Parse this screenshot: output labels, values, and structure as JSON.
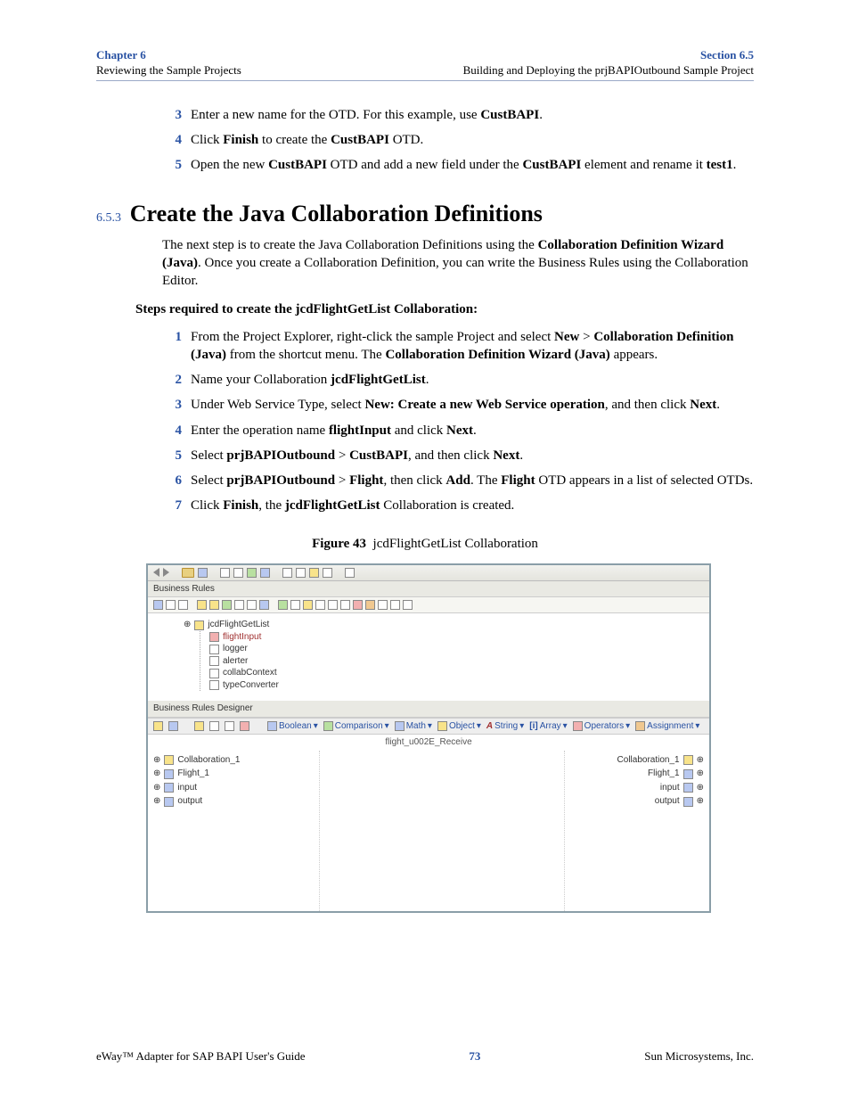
{
  "header": {
    "chapter_label": "Chapter 6",
    "chapter_sub": "Reviewing the Sample Projects",
    "section_label": "Section 6.5",
    "section_sub": "Building and Deploying the prjBAPIOutbound Sample Project"
  },
  "intro_steps": {
    "s3": {
      "n": "3",
      "pre": "Enter a new name for the OTD. For this example, use ",
      "b1": "CustBAPI",
      "post": "."
    },
    "s4": {
      "n": "4",
      "pre": "Click ",
      "b1": "Finish",
      "mid": " to create the ",
      "b2": "CustBAPI",
      "post": " OTD."
    },
    "s5": {
      "n": "5",
      "pre": "Open the new ",
      "b1": "CustBAPI",
      "mid": " OTD and add a new field under the ",
      "b2": "CustBAPI",
      "mid2": " element and rename it ",
      "b3": "test1",
      "post": "."
    }
  },
  "section": {
    "num": "6.5.3",
    "title": "Create the Java Collaboration Definitions"
  },
  "para1": {
    "pre": "The next step is to create the Java Collaboration Definitions using the ",
    "b1": "Collaboration Definition Wizard (Java)",
    "post": ". Once you create a Collaboration Definition, you can write the Business Rules using the Collaboration Editor."
  },
  "subhead": "Steps required to create the jcdFlightGetList Collaboration:",
  "steps": {
    "s1": {
      "n": "1",
      "pre": "From the Project Explorer, right-click the sample Project and select ",
      "b1": "New",
      "gt": " > ",
      "b2": "Collaboration Definition (Java)",
      "mid": " from the shortcut menu. The ",
      "b3": "Collaboration Definition Wizard (Java)",
      "post": " appears."
    },
    "s2": {
      "n": "2",
      "pre": "Name your Collaboration ",
      "b1": "jcdFlightGetList",
      "post": "."
    },
    "s3": {
      "n": "3",
      "pre": "Under Web Service Type, select ",
      "b1": "New: Create a new Web Service operation",
      "mid": ", and then click ",
      "b2": "Next",
      "post": "."
    },
    "s4": {
      "n": "4",
      "pre": "Enter the operation name ",
      "b1": "flightInput",
      "mid": " and click ",
      "b2": "Next",
      "post": "."
    },
    "s5": {
      "n": "5",
      "pre": "Select ",
      "b1": "prjBAPIOutbound",
      "gt": " > ",
      "b2": "CustBAPI",
      "mid": ", and then click ",
      "b3": "Next",
      "post": "."
    },
    "s6": {
      "n": "6",
      "pre": "Select ",
      "b1": "prjBAPIOutbound",
      "gt": " > ",
      "b2": "Flight",
      "mid": ", then click ",
      "b3": "Add",
      "mid2": ". The ",
      "b4": "Flight",
      "post": " OTD appears in a list of selected OTDs."
    },
    "s7": {
      "n": "7",
      "pre": "Click ",
      "b1": "Finish",
      "mid": ", the ",
      "b2": "jcdFlightGetList",
      "post": " Collaboration is created."
    }
  },
  "figure": {
    "label": "Figure 43",
    "caption": "jcdFlightGetList Collaboration"
  },
  "screenshot": {
    "panel1_label": "Business Rules",
    "tree": {
      "root": "jcdFlightGetList",
      "kids": [
        "flightInput",
        "logger",
        "alerter",
        "collabContext",
        "typeConverter"
      ]
    },
    "panel2_label": "Business Rules Designer",
    "designer_menu": [
      "Boolean",
      "Comparison",
      "Math",
      "Object",
      "String",
      "Array",
      "Operators",
      "Assignment"
    ],
    "center_label": "flight_u002E_Receive",
    "left_nodes": [
      "Collaboration_1",
      "Flight_1",
      "input",
      "output"
    ],
    "right_nodes": [
      "Collaboration_1",
      "Flight_1",
      "input",
      "output"
    ]
  },
  "footer": {
    "left": "eWay™ Adapter for SAP BAPI User's Guide",
    "page": "73",
    "right": "Sun Microsystems, Inc."
  }
}
